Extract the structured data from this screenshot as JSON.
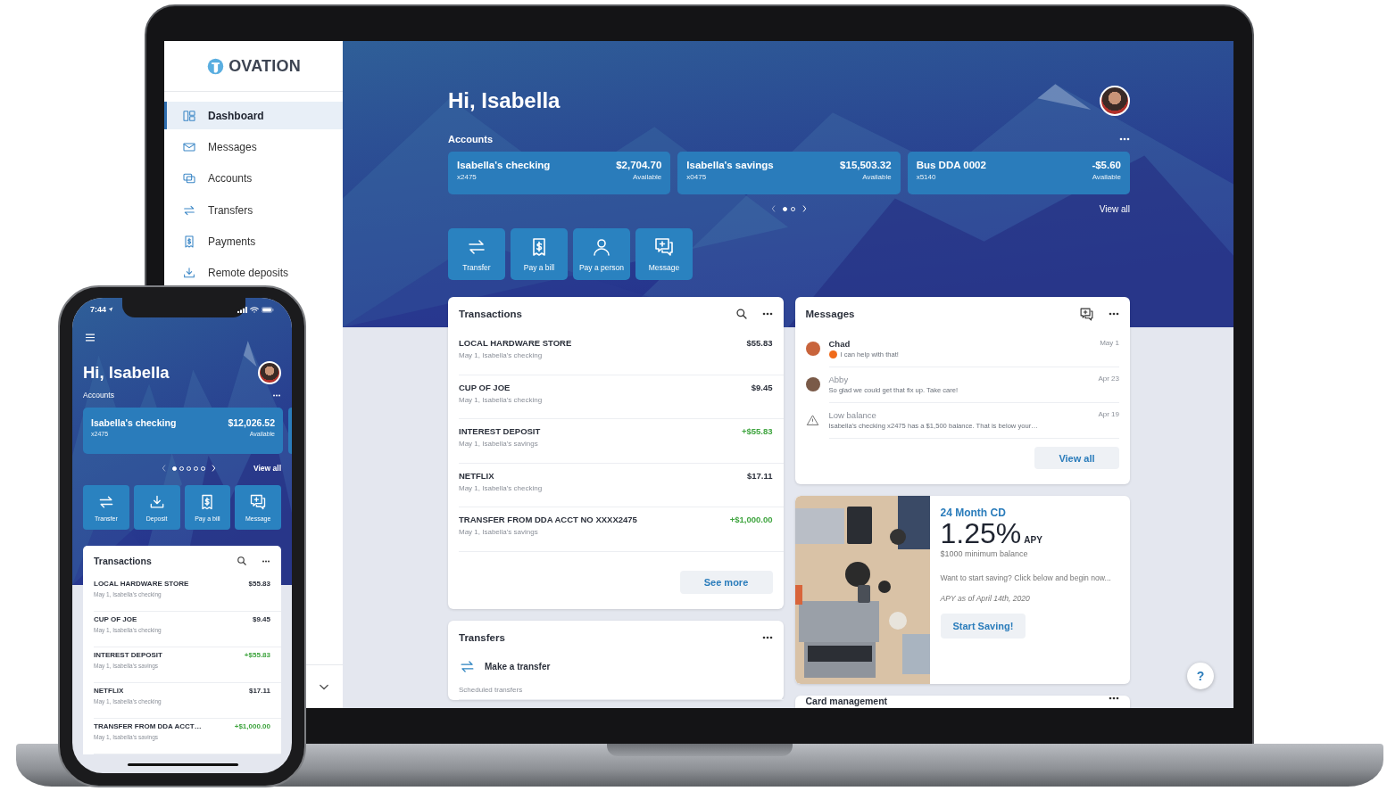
{
  "laptop": {
    "brand": "OVATION",
    "nav": [
      {
        "label": "Dashboard",
        "kind": "dashboard",
        "selected": true
      },
      {
        "label": "Messages",
        "kind": "mail",
        "selected": false
      },
      {
        "label": "Accounts",
        "kind": "accounts",
        "selected": false
      },
      {
        "label": "Transfers",
        "kind": "transfer",
        "selected": false
      },
      {
        "label": "Payments",
        "kind": "bill",
        "selected": false
      },
      {
        "label": "Remote deposits",
        "kind": "deposit",
        "selected": false
      }
    ],
    "greeting": "Hi, Isabella",
    "accounts_label": "Accounts",
    "accounts": [
      {
        "name": "Isabella's checking",
        "number": "x2475",
        "balance": "$2,704.70",
        "balance_label": "Available"
      },
      {
        "name": "Isabella's savings",
        "number": "x0475",
        "balance": "$15,503.32",
        "balance_label": "Available"
      },
      {
        "name": "Bus DDA 0002",
        "number": "x5140",
        "balance": "-$5.60",
        "balance_label": "Available"
      }
    ],
    "pager": [
      {
        "selected": true
      },
      {
        "selected": false
      }
    ],
    "view_all": "View all",
    "actions": [
      {
        "label": "Transfer",
        "kind": "transfer"
      },
      {
        "label": "Pay a bill",
        "kind": "bill"
      },
      {
        "label": "Pay a person",
        "kind": "person"
      },
      {
        "label": "Message",
        "kind": "message"
      }
    ],
    "transactions": {
      "title": "Transactions",
      "rows": [
        {
          "name": "LOCAL HARDWARE STORE",
          "detail": "May 1, Isabella's checking",
          "amount": "$55.83",
          "credit": false
        },
        {
          "name": "CUP OF JOE",
          "detail": "May 1, Isabella's checking",
          "amount": "$9.45",
          "credit": false
        },
        {
          "name": "INTEREST DEPOSIT",
          "detail": "May 1, Isabella's savings",
          "amount": "+$55.83",
          "credit": true
        },
        {
          "name": "NETFLIX",
          "detail": "May 1, Isabella's checking",
          "amount": "$17.11",
          "credit": false
        },
        {
          "name": "TRANSFER FROM DDA ACCT NO XXXX2475",
          "detail": "May 1, Isabella's savings",
          "amount": "+$1,000.00",
          "credit": true
        }
      ],
      "see_more": "See more"
    },
    "transfers": {
      "title": "Transfers",
      "action": "Make a transfer",
      "subheading": "Scheduled transfers"
    },
    "messages": {
      "title": "Messages",
      "items": [
        {
          "kind": "person",
          "sender": "Chad",
          "preview": "I can help with that!",
          "date": "May 1",
          "unread": true,
          "color": "#c8643c"
        },
        {
          "kind": "person",
          "sender": "Abby",
          "preview": "So glad we could get that fix up. Take care!",
          "date": "Apr 23",
          "unread": false,
          "color": "#7a5a48"
        },
        {
          "kind": "alert",
          "sender": "Low balance",
          "preview": "Isabella's checking x2475 has a $1,500 balance. That is below your…",
          "date": "Apr 19",
          "unread": false
        }
      ],
      "view_all": "View all"
    },
    "promo": {
      "title": "24 Month CD",
      "rate": "1.25%",
      "rate_unit": "APY",
      "note": "$1000 minimum balance",
      "body": "Want to start saving? Click below and begin now...",
      "disclaimer": "APY as of April 14th, 2020",
      "button": "Start Saving!"
    },
    "card_management": {
      "title": "Card management"
    },
    "help": "?"
  },
  "phone": {
    "time": "7:44",
    "greeting": "Hi, Isabella",
    "accounts_label": "Accounts",
    "account": {
      "name": "Isabella's checking",
      "number": "x2475",
      "balance": "$12,026.52",
      "balance_label": "Available"
    },
    "pager": [
      {
        "selected": true
      },
      {
        "selected": false
      },
      {
        "selected": false
      },
      {
        "selected": false
      },
      {
        "selected": false
      }
    ],
    "view_all": "View all",
    "actions": [
      {
        "label": "Transfer",
        "kind": "transfer"
      },
      {
        "label": "Deposit",
        "kind": "deposit"
      },
      {
        "label": "Pay a bill",
        "kind": "bill"
      },
      {
        "label": "Message",
        "kind": "message"
      }
    ],
    "transactions": {
      "title": "Transactions",
      "rows": [
        {
          "name": "LOCAL HARDWARE STORE",
          "detail": "May 1, Isabella's checking",
          "amount": "$55.83",
          "credit": false
        },
        {
          "name": "CUP OF JOE",
          "detail": "May 1, Isabella's checking",
          "amount": "$9.45",
          "credit": false
        },
        {
          "name": "INTEREST DEPOSIT",
          "detail": "May 1, Isabella's savings",
          "amount": "+$55.83",
          "credit": true
        },
        {
          "name": "NETFLIX",
          "detail": "May 1, Isabella's checking",
          "amount": "$17.11",
          "credit": false
        },
        {
          "name": "TRANSFER FROM DDA ACCT…",
          "detail": "May 1, Isabella's savings",
          "amount": "+$1,000.00",
          "credit": true
        }
      ]
    }
  }
}
